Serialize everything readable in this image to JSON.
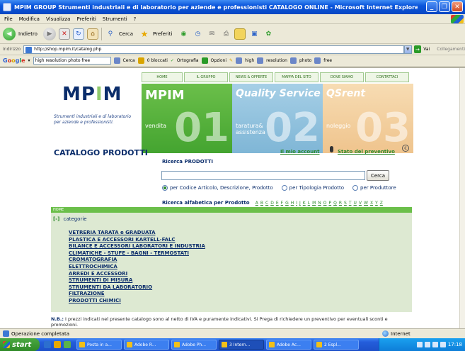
{
  "window": {
    "title": "MPIM GROUP Strumenti industriali e di laboratorio per aziende e professionisti CATALOGO ONLINE - Microsoft Internet Explorer"
  },
  "menu": [
    "File",
    "Modifica",
    "Visualizza",
    "Preferiti",
    "Strumenti",
    "?"
  ],
  "toolbar": {
    "back_label": "Indietro",
    "search_label": "Cerca",
    "favorites_label": "Preferiti"
  },
  "address": {
    "label": "Indirizzo",
    "url": "http://shop.mpim.it/catalog.php",
    "go_label": "Vai",
    "links_label": "Collegamenti"
  },
  "google_bar": {
    "query": "high resolution photo free",
    "search_label": "Cerca",
    "blocked_label": "0 bloccati",
    "spell_label": "Ortografia",
    "options_label": "Opzioni",
    "terms": [
      "high",
      "resolution",
      "photo",
      "free"
    ]
  },
  "site": {
    "nav": [
      "HOME",
      "IL GRUPPO",
      "NEWS & OFFERTE",
      "MAPPA DEL SITO",
      "DOVE SIAMO",
      "CONTATTACI"
    ],
    "brand": {
      "pre": "MP",
      "dot": "I",
      "post": "M",
      "tagline": "Strumenti industriali e di laboratorio per aziende e professionisti."
    },
    "panels": [
      {
        "title": "MPIM",
        "subtitle": "vendita",
        "number": "01"
      },
      {
        "title": "Quality Service",
        "subtitle": "taratura&\nassistenza",
        "number": "02"
      },
      {
        "title": "QSrent",
        "subtitle": "noleggio",
        "number": "03"
      }
    ],
    "catalog_title": "CATALOGO PRODOTTI",
    "account_link": "Il mio account",
    "quote_link": "Stato del preventivo",
    "search": {
      "label": "Ricerca PRODOTTI",
      "value": "",
      "button": "Cerca",
      "options": [
        {
          "label": "per Codice Articolo, Descrizione, Prodotto",
          "selected": true
        },
        {
          "label": "per Tipologia Prodotto",
          "selected": false
        },
        {
          "label": "per Produttore",
          "selected": false
        }
      ]
    },
    "alpha": {
      "label": "Ricerca alfabetica per Prodotto",
      "letters": [
        "A",
        "B",
        "C",
        "D",
        "E",
        "F",
        "G",
        "H",
        "I",
        "J",
        "K",
        "L",
        "M",
        "N",
        "O",
        "P",
        "Q",
        "R",
        "S",
        "T",
        "U",
        "V",
        "W",
        "X",
        "Y",
        "Z"
      ]
    },
    "home_bar": "HOME",
    "categories_heading": "categorie",
    "categories": [
      "VETRERIA TARATA e GRADUATA",
      "PLASTICA E ACCESSORI KARTELL-FALC",
      "BILANCE E ACCESSORI LABORATORI E INDUSTRIA",
      "CLIMATICHE - STUFE - BAGNI - TERMOSTATI",
      "CROMATOGRAFIA",
      "ELETTROCHIMICA",
      "ARREDI E ACCESSORI",
      "STRUMENTI DI MISURA",
      "STRUMENTI DA LABORATORIO",
      "FILTRAZIONE",
      "PRODOTTI CHIMICI"
    ],
    "note_label": "N.B.:",
    "note_text": "I prezzi indicati nel presente catalogo sono al netto di IVA e puramente indicativi. Si Prega di richiedere un preventivo per eventuali sconti e promozioni."
  },
  "status": {
    "text": "Operazione completata",
    "zone": "Internet"
  },
  "taskbar": {
    "start_label": "start",
    "tasks": [
      "Posta in a...",
      "Adobe R...",
      "Adobe Ph...",
      "3 Intern...",
      "Adobe Ac...",
      "2 Espl..."
    ],
    "clock": "17:18"
  },
  "colors": {
    "brand_blue": "#0b2d6b",
    "brand_green": "#6bbf4a",
    "quality_blue": "#7fb6d6",
    "rent_orange": "#efc48d",
    "category_bg": "#dde9d2"
  }
}
